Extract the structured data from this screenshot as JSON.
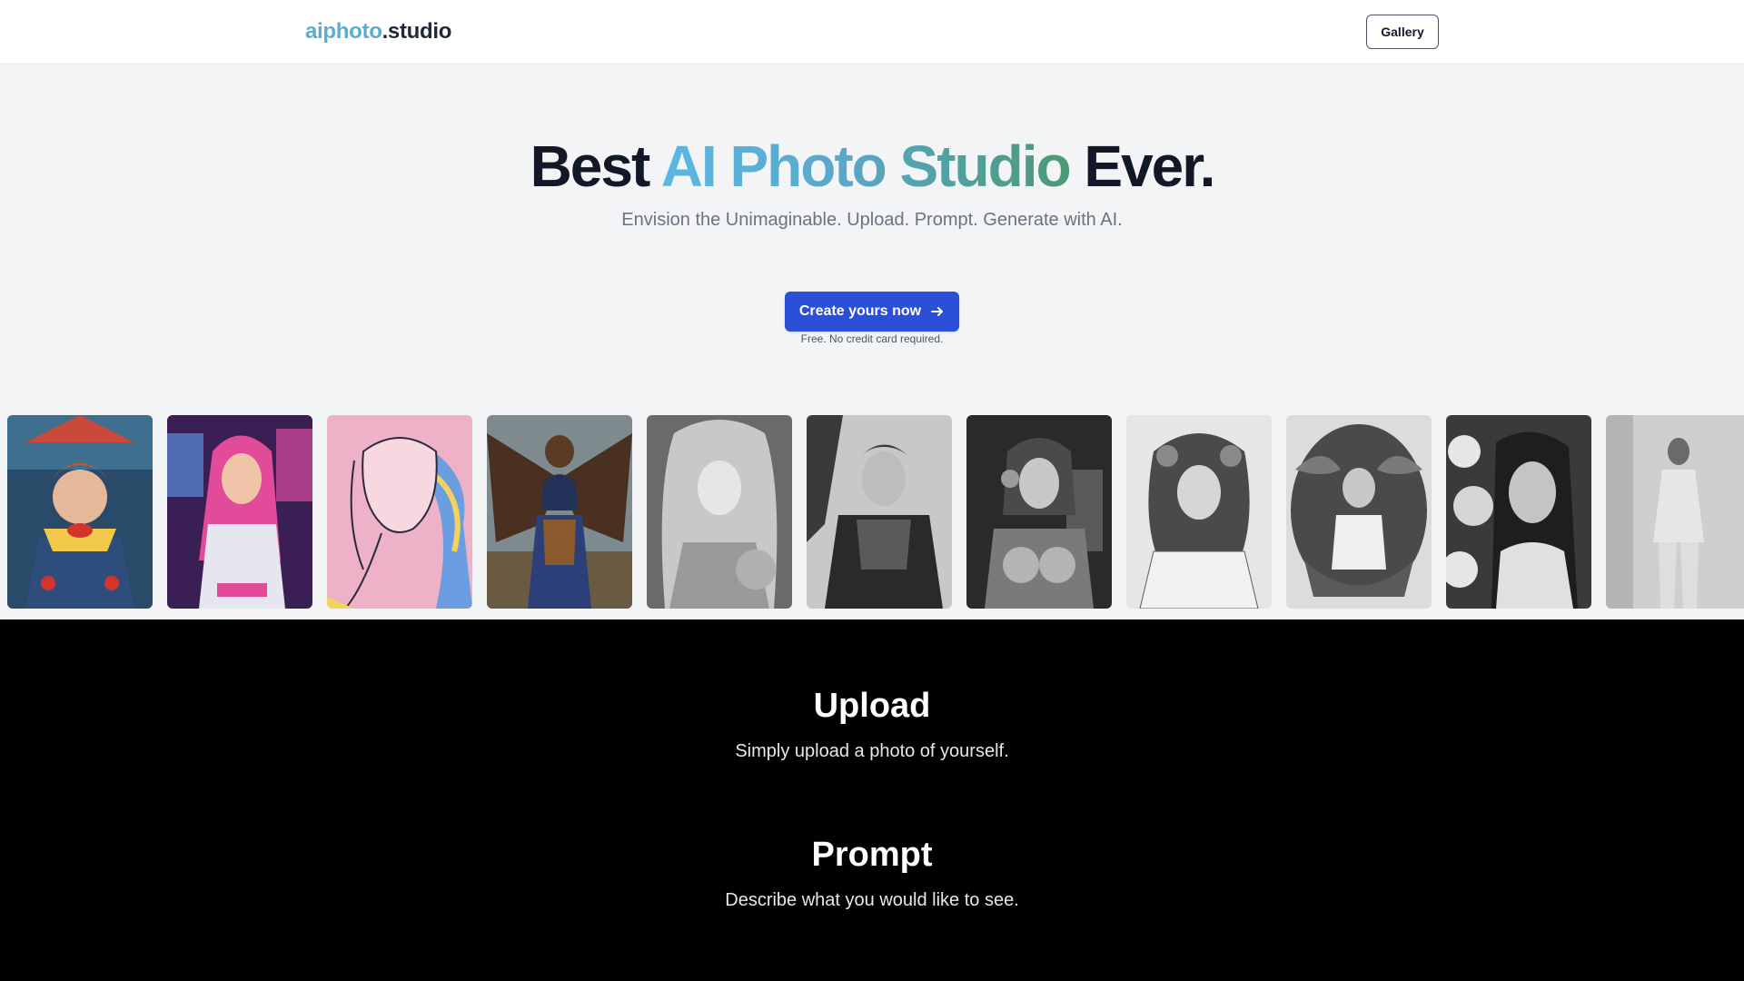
{
  "header": {
    "logo_part1": "aiphoto",
    "logo_part2": ".studio",
    "gallery_label": "Gallery"
  },
  "hero": {
    "title_start": "Best ",
    "title_highlight": "AI Photo Studio",
    "title_end": " Ever.",
    "subtitle": "Envision the Unimaginable. Upload. Prompt. Generate with AI.",
    "cta_label": "Create yours now",
    "cta_icon": "arrow-right-icon",
    "cta_note": "Free. No credit card required."
  },
  "gallery_strip": {
    "photos": [
      {
        "name": "clown-portrait",
        "style": "color"
      },
      {
        "name": "arcade-girl-portrait",
        "style": "color"
      },
      {
        "name": "line-art-portrait",
        "style": "color"
      },
      {
        "name": "steampunk-eagle-portrait",
        "style": "color"
      },
      {
        "name": "silver-fantasy-portrait",
        "style": "grayscale"
      },
      {
        "name": "armored-knight-portrait",
        "style": "grayscale"
      },
      {
        "name": "cyborg-portrait",
        "style": "grayscale"
      },
      {
        "name": "floral-princess-portrait",
        "style": "grayscale"
      },
      {
        "name": "tropical-leaves-portrait",
        "style": "grayscale"
      },
      {
        "name": "winter-portrait",
        "style": "grayscale"
      },
      {
        "name": "fashion-suit-portrait",
        "style": "grayscale"
      }
    ]
  },
  "steps": [
    {
      "title": "Upload",
      "description": "Simply upload a photo of yourself."
    },
    {
      "title": "Prompt",
      "description": "Describe what you would like to see."
    }
  ],
  "colors": {
    "brand_blue": "#5aafd0",
    "brand_green": "#4a9a74",
    "cta_blue": "#2c4fd7"
  }
}
